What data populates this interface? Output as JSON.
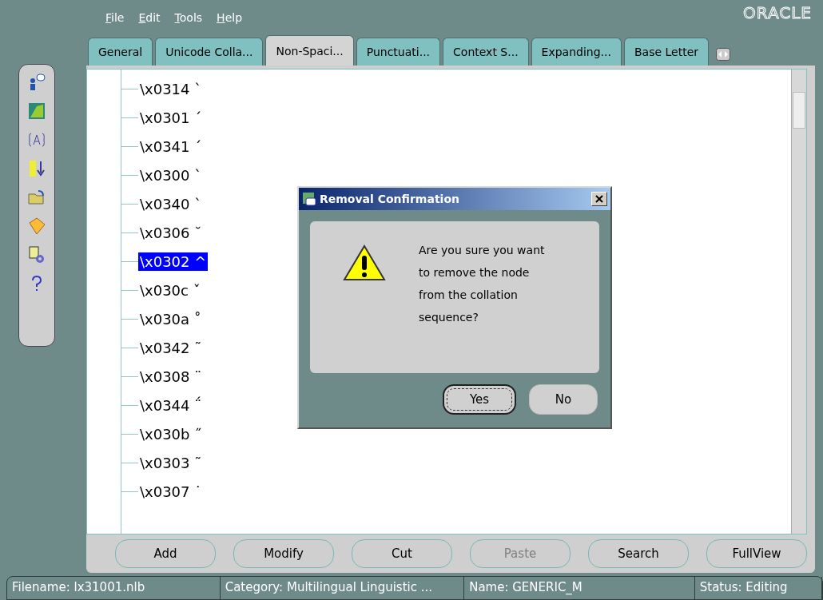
{
  "menu": [
    "File",
    "Edit",
    "Tools",
    "Help"
  ],
  "brand": "ORACLE",
  "tabs": [
    {
      "label": "General",
      "selected": false
    },
    {
      "label": "Unicode Colla...",
      "selected": false
    },
    {
      "label": "Non-Spaci...",
      "selected": true
    },
    {
      "label": "Punctuati...",
      "selected": false
    },
    {
      "label": "Context S...",
      "selected": false
    },
    {
      "label": "Expanding...",
      "selected": false
    },
    {
      "label": "Base Letter",
      "selected": false
    }
  ],
  "tree": [
    {
      "label": "\\x0314 `",
      "selected": false
    },
    {
      "label": "\\x0301 ´",
      "selected": false
    },
    {
      "label": "\\x0341 ´",
      "selected": false
    },
    {
      "label": "\\x0300 `",
      "selected": false
    },
    {
      "label": "\\x0340 `",
      "selected": false
    },
    {
      "label": "\\x0306 ˘",
      "selected": false
    },
    {
      "label": "\\x0302 ^",
      "selected": true
    },
    {
      "label": "\\x030c ˇ",
      "selected": false
    },
    {
      "label": "\\x030a ˚",
      "selected": false
    },
    {
      "label": "\\x0342 ˜",
      "selected": false
    },
    {
      "label": "\\x0308 ¨",
      "selected": false
    },
    {
      "label": "\\x0344 ΅",
      "selected": false
    },
    {
      "label": "\\x030b ˝",
      "selected": false
    },
    {
      "label": "\\x0303 ˜",
      "selected": false
    },
    {
      "label": "\\x0307 ˙",
      "selected": false
    }
  ],
  "buttons": [
    {
      "label": "Add",
      "disabled": false
    },
    {
      "label": "Modify",
      "disabled": false
    },
    {
      "label": "Cut",
      "disabled": false
    },
    {
      "label": "Paste",
      "disabled": true
    },
    {
      "label": "Search",
      "disabled": false
    },
    {
      "label": "FullView",
      "disabled": false
    }
  ],
  "status_bar": [
    "Filename: lx31001.nlb",
    "Category: Multilingual Linguistic ...",
    "Name: GENERIC_M",
    "Status: Editing"
  ],
  "dialog": {
    "title": "Removal Confirmation",
    "message": "Are you sure you want to remove the node from the collation sequence?",
    "buttons": [
      {
        "label": "Yes",
        "focused": true
      },
      {
        "label": "No",
        "focused": false
      }
    ]
  }
}
